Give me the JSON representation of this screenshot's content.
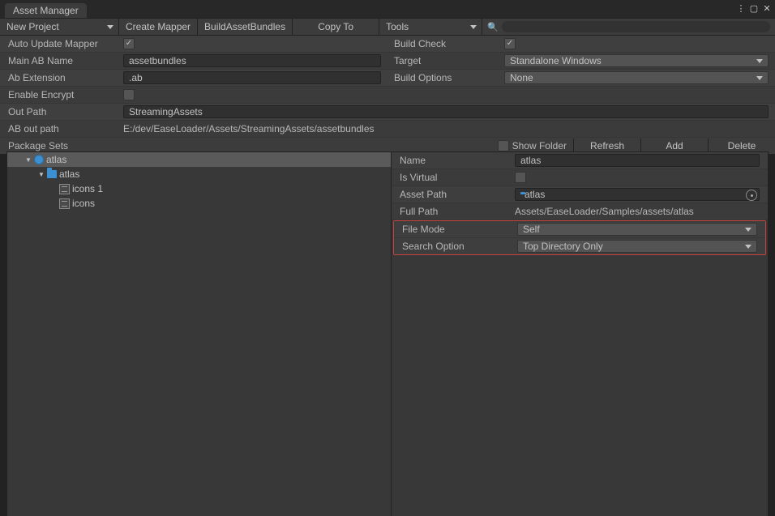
{
  "title": "Asset Manager",
  "toolbar": {
    "project": "New Project",
    "create_mapper": "Create Mapper",
    "build_bundles": "BuildAssetBundles",
    "copy_to": "Copy To",
    "tools": "Tools",
    "search_placeholder": ""
  },
  "settings": {
    "auto_update_label": "Auto Update Mapper",
    "auto_update_checked": "✓",
    "build_check_label": "Build Check",
    "build_check_checked": "✓",
    "main_ab_label": "Main AB Name",
    "main_ab_value": "assetbundles",
    "target_label": "Target",
    "target_value": "Standalone Windows",
    "ab_ext_label": "Ab Extension",
    "ab_ext_value": ".ab",
    "build_opts_label": "Build Options",
    "build_opts_value": "None",
    "enable_encrypt_label": "Enable Encrypt",
    "out_path_label": "Out Path",
    "out_path_value": "StreamingAssets",
    "ab_out_label": "AB out path",
    "ab_out_value": "E:/dev/EaseLoader/Assets/StreamingAssets/assetbundles"
  },
  "pkghdr": {
    "label": "Package Sets",
    "show_folder": "Show Folder",
    "refresh": "Refresh",
    "add": "Add",
    "delete": "Delete"
  },
  "tree": {
    "items": [
      {
        "indent": 0,
        "fold": "▼",
        "name": "atlas",
        "sel": true,
        "icon": "dot"
      },
      {
        "indent": 1,
        "fold": "▼",
        "name": "atlas",
        "sel": false,
        "icon": "folder"
      },
      {
        "indent": 2,
        "fold": "",
        "name": "icons 1",
        "sel": false,
        "icon": "item"
      },
      {
        "indent": 2,
        "fold": "",
        "name": "icons",
        "sel": false,
        "icon": "item"
      }
    ]
  },
  "inspector": {
    "name_label": "Name",
    "name_value": "atlas",
    "is_virtual_label": "Is Virtual",
    "asset_path_label": "Asset Path",
    "asset_path_value": "atlas",
    "full_path_label": "Full Path",
    "full_path_value": "Assets/EaseLoader/Samples/assets/atlas",
    "file_mode_label": "File Mode",
    "file_mode_value": "Self",
    "search_opt_label": "Search Option",
    "search_opt_value": "Top Directory Only"
  }
}
